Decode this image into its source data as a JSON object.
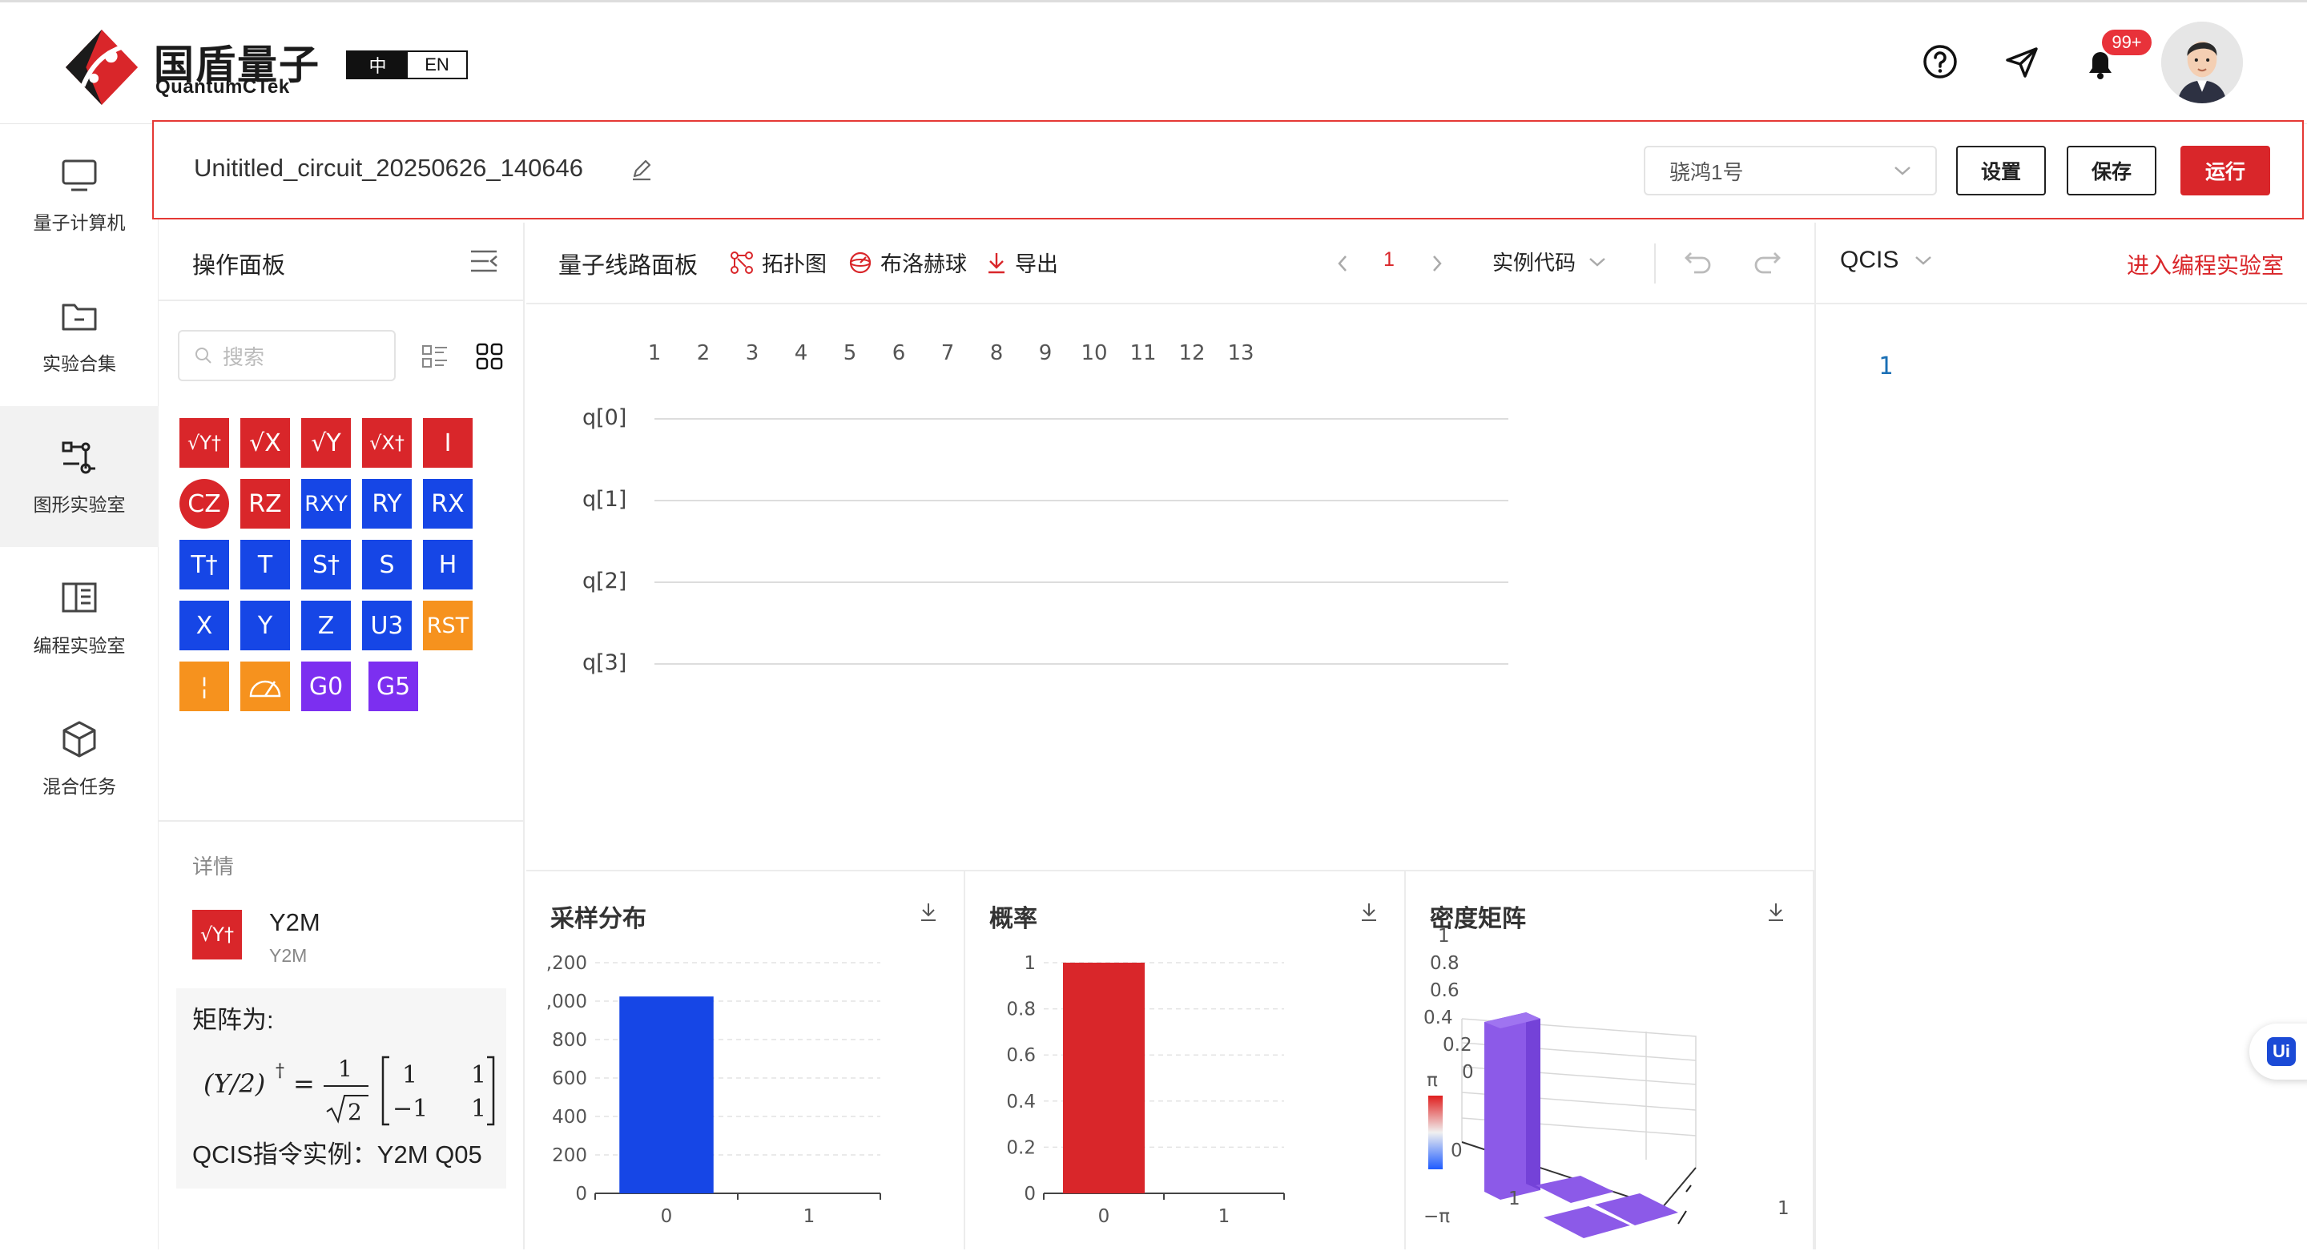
{
  "header": {
    "logo_cn": "国盾量子",
    "logo_en": "QuantumCTek",
    "lang_zh": "中",
    "lang_en": "EN",
    "notification_count": "99+",
    "icons": [
      "help-icon",
      "send-icon",
      "bell-icon"
    ]
  },
  "sidebar": {
    "items": [
      {
        "label": "量子计算机",
        "icon": "monitor-icon"
      },
      {
        "label": "实验合集",
        "icon": "folder-icon"
      },
      {
        "label": "图形实验室",
        "icon": "circuit-icon",
        "active": true
      },
      {
        "label": "编程实验室",
        "icon": "book-icon"
      },
      {
        "label": "混合任务",
        "icon": "cube-icon"
      }
    ]
  },
  "titlebar": {
    "circuit_name": "Unititled_circuit_20250626_140646",
    "device": "骁鸿1号",
    "settings_label": "设置",
    "save_label": "保存",
    "run_label": "运行"
  },
  "ops_panel": {
    "title": "操作面板",
    "search_placeholder": "搜索",
    "gates": [
      [
        {
          "label": "√Y†",
          "color": "red"
        },
        {
          "label": "√X",
          "color": "red"
        },
        {
          "label": "√Y",
          "color": "red"
        },
        {
          "label": "√X†",
          "color": "red"
        },
        {
          "label": "I",
          "color": "red"
        }
      ],
      [
        {
          "label": "CZ",
          "color": "red",
          "round": true
        },
        {
          "label": "RZ",
          "color": "red"
        },
        {
          "label": "RXY",
          "color": "blue"
        },
        {
          "label": "RY",
          "color": "blue"
        },
        {
          "label": "RX",
          "color": "blue"
        }
      ],
      [
        {
          "label": "T†",
          "color": "blue"
        },
        {
          "label": "T",
          "color": "blue"
        },
        {
          "label": "S†",
          "color": "blue"
        },
        {
          "label": "S",
          "color": "blue"
        },
        {
          "label": "H",
          "color": "blue"
        }
      ],
      [
        {
          "label": "X",
          "color": "blue"
        },
        {
          "label": "Y",
          "color": "blue"
        },
        {
          "label": "Z",
          "color": "blue"
        },
        {
          "label": "U3",
          "color": "blue"
        },
        {
          "label": "RST",
          "color": "orange"
        }
      ],
      [
        {
          "label": "¦",
          "color": "orange"
        },
        {
          "label": "meter",
          "color": "orange"
        },
        {
          "label": "G0",
          "color": "purple"
        },
        {
          "label": "G5",
          "color": "purple"
        }
      ]
    ],
    "details": {
      "label": "详情",
      "gate_symbol": "√Y†",
      "name": "Y2M",
      "sub": "Y2M",
      "matrix_label": "矩阵为:",
      "qcis_example": "QCIS指令实例：Y2M Q05"
    }
  },
  "circuit_panel": {
    "title": "量子线路面板",
    "topology": "拓扑图",
    "bloch": "布洛赫球",
    "export": "导出",
    "page": "1",
    "example_code": "实例代码",
    "columns": [
      "1",
      "2",
      "3",
      "4",
      "5",
      "6",
      "7",
      "8",
      "9",
      "10",
      "11",
      "12",
      "13"
    ],
    "qubits": [
      "q[0]",
      "q[1]",
      "q[2]",
      "q[3]"
    ]
  },
  "code_panel": {
    "language": "QCIS",
    "enter_lab": "进入编程实验室",
    "line_numbers": [
      "1"
    ]
  },
  "charts": {
    "sampling": {
      "title": "采样分布",
      "y_ticks": [
        "0",
        "200",
        "400",
        "600",
        "800",
        ",000",
        ",200"
      ],
      "x_ticks": [
        "0",
        "1"
      ]
    },
    "probability": {
      "title": "概率",
      "y_ticks": [
        "0",
        "0.2",
        "0.4",
        "0.6",
        "0.8",
        "1"
      ],
      "x_ticks": [
        "0",
        "1"
      ]
    },
    "density": {
      "title": "密度矩阵",
      "z_ticks": [
        "0",
        "0.2",
        "0.4",
        "0.6",
        "0.8",
        "1"
      ],
      "colorbar_min": "−π",
      "colorbar_max": "π",
      "axis_labels": [
        "0",
        "1",
        "1"
      ]
    }
  },
  "chart_data": [
    {
      "type": "bar",
      "title": "采样分布",
      "categories": [
        "0",
        "1"
      ],
      "values": [
        1024,
        0
      ],
      "ylim": [
        0,
        1200
      ],
      "color": "#1646e6"
    },
    {
      "type": "bar",
      "title": "概率",
      "categories": [
        "0",
        "1"
      ],
      "values": [
        1,
        0
      ],
      "ylim": [
        0,
        1
      ],
      "color": "#d9262a"
    }
  ],
  "colors": {
    "accent": "#d9262a",
    "blue": "#1646e6",
    "orange": "#f6921e",
    "purple": "#7c2ff0"
  }
}
